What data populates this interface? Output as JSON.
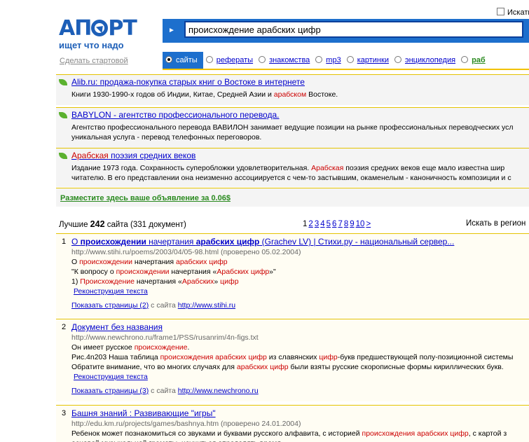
{
  "logo": {
    "name": "АПОРТ",
    "tagline": "ищет что надо",
    "start_link": "Сделать стартовой"
  },
  "search": {
    "query": "происхождение арабских цифр",
    "checkbox_label": "Искать"
  },
  "tabs": [
    {
      "label": "сайты",
      "active": true
    },
    {
      "label": "рефераты",
      "active": false
    },
    {
      "label": "знакомства",
      "active": false
    },
    {
      "label": "mp3",
      "active": false
    },
    {
      "label": "картинки",
      "active": false
    },
    {
      "label": "энциклопедия",
      "active": false
    },
    {
      "label": "раб",
      "active": false
    }
  ],
  "ads": [
    {
      "title": "Alib.ru: продажа-покупка старых книг о Востоке в интернете",
      "lines": [
        [
          "Книги 1930-1990-х годов об Индии, Китае, Средней Азии и ",
          "арабском",
          " Востоке."
        ]
      ]
    },
    {
      "title": "BABYLON - агентство профессионального перевода.",
      "lines": [
        [
          "Агентство профессионального перевода ВАВИЛОН занимает ведущие позиции на рынке профессиональных переводческих усл"
        ],
        [
          "уникальная услуга - перевод телефонных переговоров."
        ]
      ]
    },
    {
      "title_hl": "Арабская",
      "title": " поэзия средних веков",
      "lines": [
        [
          "Издание 1973 года. Сохранность суперобложки удовлетворительная. ",
          "Арабская",
          " поэзия средних веков еще мало известна шир"
        ],
        [
          "читателю. В его представлении она неизменно ассоциируется с чем-то застывшим, окаменелым - каноничность композиции и с"
        ]
      ]
    }
  ],
  "promo": "Разместите здесь ваше объявление за 0.06$",
  "summary": {
    "prefix": "Лучшие ",
    "count": "242",
    "suffix": " сайта (331 документ)",
    "region": "Искать в регион"
  },
  "pager": [
    "1",
    "2",
    "3",
    "4",
    "5",
    "6",
    "7",
    "8",
    "9",
    "10",
    ">"
  ],
  "results": [
    {
      "num": "1",
      "title": [
        "О ",
        "происхождении",
        " начертания ",
        "арабских цифр",
        " (Grachev LV) | Стихи.ру - национальный сервер..."
      ],
      "url": "http://www.stihi.ru/poems/2003/04/05-98.html (проверено 05.02.2004)",
      "snippets": [
        [
          "О ",
          "происхождении",
          " начертания ",
          "арабских цифр"
        ],
        [
          "\"К вопросу о ",
          "происхождении",
          " начертания «",
          "Арабских цифр",
          "»\""
        ],
        [
          "1) ",
          "Происхождение",
          " начертания «",
          "Арабских",
          "» ",
          "цифр"
        ]
      ],
      "reconstruct": "Реконструкция текста",
      "show_pages": "Показать страницы (2)",
      "from_site": " с сайта ",
      "site": "http://www.stihi.ru"
    },
    {
      "num": "2",
      "title": [
        "Документ без названия"
      ],
      "url": "http://www.newchrono.ru/frame1/PSS/rusanrim/4n-figs.txt",
      "snippets": [
        [
          "Он имеет русское ",
          "происхождение",
          "."
        ],
        [
          "Рис.4n203 Наша таблица ",
          "происхождения арабских цифр",
          " из славянских ",
          "цифр",
          "-букв предшествующей полу-позиционной системы"
        ],
        [
          "Обратите внимание, что во многих случаях для ",
          "арабских цифр",
          " были взяты русские скорописные формы кириллических букв."
        ]
      ],
      "reconstruct": "Реконструкция текста",
      "show_pages": "Показать страницы (3)",
      "from_site": " с сайта ",
      "site": "http://www.newchrono.ru"
    },
    {
      "num": "3",
      "title": [
        "Башня знаний : Развивающие \"игры\""
      ],
      "url": "http://edu.km.ru/projects/games/bashnya.htm (проверено 24.01.2004)",
      "snippets": [
        [
          "Ребенок может познакомиться со звуками и буквами русского алфавита, с историей ",
          "происхождения арабских цифр",
          ", с картой з"
        ],
        [
          "основой музыкальной грамоты, научиться определять время..."
        ]
      ]
    }
  ]
}
